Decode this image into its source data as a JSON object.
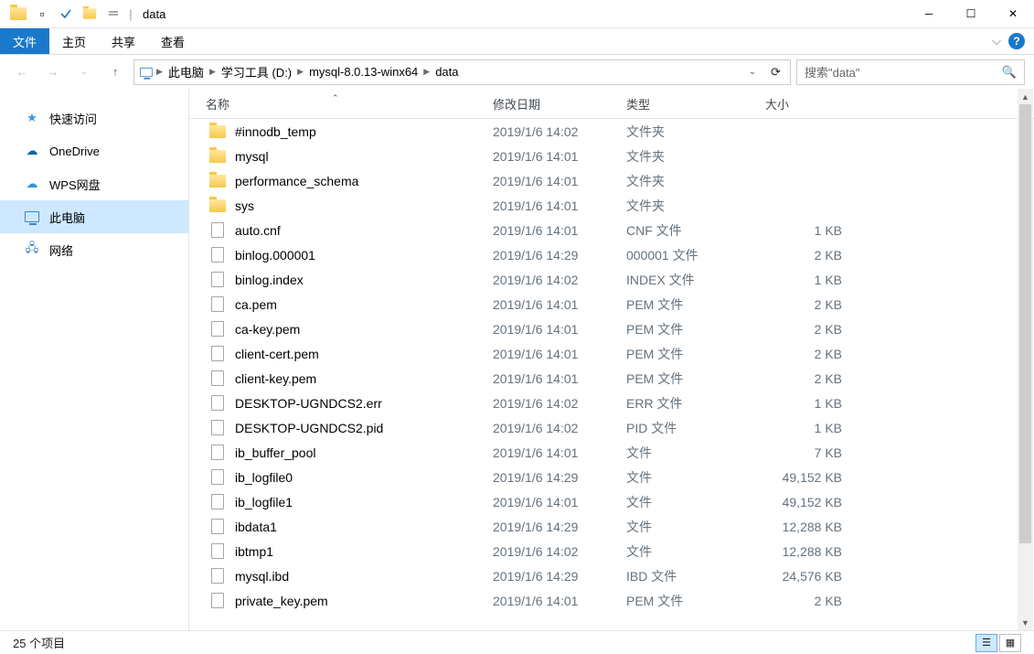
{
  "title": "data",
  "ribbon": {
    "file": "文件",
    "home": "主页",
    "share": "共享",
    "view": "查看"
  },
  "breadcrumbs": [
    "此电脑",
    "学习工具 (D:)",
    "mysql-8.0.13-winx64",
    "data"
  ],
  "search_placeholder": "搜索\"data\"",
  "nav": {
    "quick": "快速访问",
    "onedrive": "OneDrive",
    "wps": "WPS网盘",
    "pc": "此电脑",
    "network": "网络"
  },
  "columns": {
    "name": "名称",
    "date": "修改日期",
    "type": "类型",
    "size": "大小"
  },
  "files": [
    {
      "name": "#innodb_temp",
      "date": "2019/1/6 14:02",
      "type": "文件夹",
      "size": "",
      "kind": "folder"
    },
    {
      "name": "mysql",
      "date": "2019/1/6 14:01",
      "type": "文件夹",
      "size": "",
      "kind": "folder"
    },
    {
      "name": "performance_schema",
      "date": "2019/1/6 14:01",
      "type": "文件夹",
      "size": "",
      "kind": "folder"
    },
    {
      "name": "sys",
      "date": "2019/1/6 14:01",
      "type": "文件夹",
      "size": "",
      "kind": "folder"
    },
    {
      "name": "auto.cnf",
      "date": "2019/1/6 14:01",
      "type": "CNF 文件",
      "size": "1 KB",
      "kind": "file"
    },
    {
      "name": "binlog.000001",
      "date": "2019/1/6 14:29",
      "type": "000001 文件",
      "size": "2 KB",
      "kind": "file"
    },
    {
      "name": "binlog.index",
      "date": "2019/1/6 14:02",
      "type": "INDEX 文件",
      "size": "1 KB",
      "kind": "file"
    },
    {
      "name": "ca.pem",
      "date": "2019/1/6 14:01",
      "type": "PEM 文件",
      "size": "2 KB",
      "kind": "file"
    },
    {
      "name": "ca-key.pem",
      "date": "2019/1/6 14:01",
      "type": "PEM 文件",
      "size": "2 KB",
      "kind": "file"
    },
    {
      "name": "client-cert.pem",
      "date": "2019/1/6 14:01",
      "type": "PEM 文件",
      "size": "2 KB",
      "kind": "file"
    },
    {
      "name": "client-key.pem",
      "date": "2019/1/6 14:01",
      "type": "PEM 文件",
      "size": "2 KB",
      "kind": "file"
    },
    {
      "name": "DESKTOP-UGNDCS2.err",
      "date": "2019/1/6 14:02",
      "type": "ERR 文件",
      "size": "1 KB",
      "kind": "file"
    },
    {
      "name": "DESKTOP-UGNDCS2.pid",
      "date": "2019/1/6 14:02",
      "type": "PID 文件",
      "size": "1 KB",
      "kind": "file"
    },
    {
      "name": "ib_buffer_pool",
      "date": "2019/1/6 14:01",
      "type": "文件",
      "size": "7 KB",
      "kind": "file"
    },
    {
      "name": "ib_logfile0",
      "date": "2019/1/6 14:29",
      "type": "文件",
      "size": "49,152 KB",
      "kind": "file"
    },
    {
      "name": "ib_logfile1",
      "date": "2019/1/6 14:01",
      "type": "文件",
      "size": "49,152 KB",
      "kind": "file"
    },
    {
      "name": "ibdata1",
      "date": "2019/1/6 14:29",
      "type": "文件",
      "size": "12,288 KB",
      "kind": "file"
    },
    {
      "name": "ibtmp1",
      "date": "2019/1/6 14:02",
      "type": "文件",
      "size": "12,288 KB",
      "kind": "file"
    },
    {
      "name": "mysql.ibd",
      "date": "2019/1/6 14:29",
      "type": "IBD 文件",
      "size": "24,576 KB",
      "kind": "file"
    },
    {
      "name": "private_key.pem",
      "date": "2019/1/6 14:01",
      "type": "PEM 文件",
      "size": "2 KB",
      "kind": "file"
    }
  ],
  "status": "25 个项目"
}
